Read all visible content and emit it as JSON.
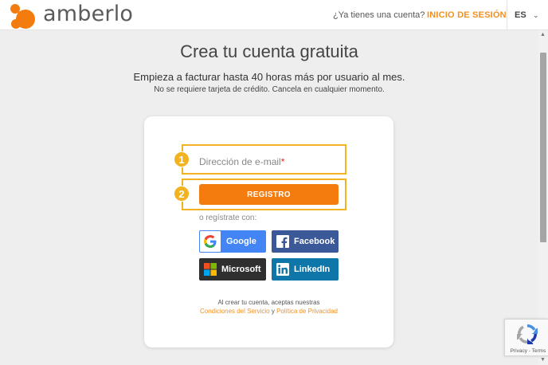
{
  "brand": {
    "name": "amberlo",
    "accent": "#f47c0f",
    "logo_icon": "amberlo-logo-icon"
  },
  "header": {
    "question": "¿Ya tienes una cuenta?",
    "login_label": "INICIO DE SESIÓN",
    "language": "ES",
    "language_chevron": "chevron-down-icon"
  },
  "page": {
    "title": "Crea tu cuenta gratuita",
    "subtitle": "Empieza a facturar hasta 40 horas más por usuario al mes.",
    "note": "No se requiere tarjeta de crédito. Cancela en cualquier momento."
  },
  "form": {
    "email_placeholder": "Dirección de e-mail",
    "required_mark": "*",
    "register_label": "REGISTRO",
    "or_text": "o regístrate con:",
    "social": {
      "google": "Google",
      "facebook": "Facebook",
      "microsoft": "Microsoft",
      "linkedin": "LinkedIn"
    },
    "legal_prefix": "Al crear tu cuenta, aceptas nuestras",
    "terms_link": "Condiciones del Servicio",
    "legal_and": "y",
    "privacy_link": "Política de Privacidad"
  },
  "annotations": {
    "step1": "1",
    "step2": "2",
    "highlight_color": "#f3b21f"
  },
  "recaptcha": {
    "privacy": "Privacy",
    "separator": "-",
    "terms": "Terms"
  }
}
